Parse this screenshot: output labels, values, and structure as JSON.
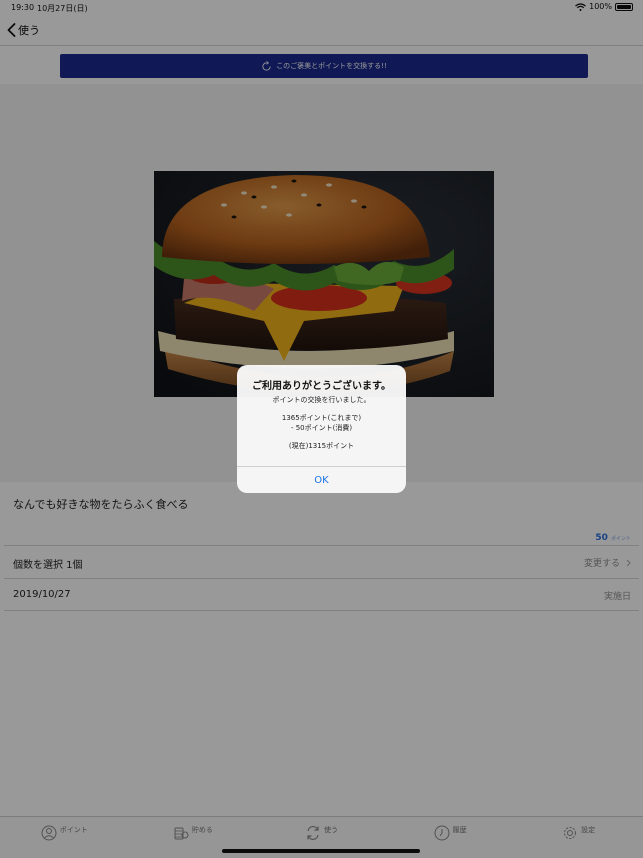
{
  "status_bar": {
    "time": "19:30",
    "date": "10月27日(日)",
    "battery": "100%"
  },
  "nav": {
    "back_label": "使う"
  },
  "exchange_button": {
    "label": "このご褒美とポイントを交換する!!"
  },
  "product": {
    "image": "hamburger-photo",
    "description": "なんでも好きな物をたらふく食べる",
    "points_value": "50",
    "points_unit": "ポイント"
  },
  "quantity_row": {
    "label": "個数を選択 1個",
    "action": "変更する"
  },
  "date_row": {
    "date": "2019/10/27",
    "label": "実施日"
  },
  "tab_bar": {
    "tabs": [
      {
        "label": "ポイント",
        "icon": "person-icon"
      },
      {
        "label": "貯める",
        "icon": "coins-icon"
      },
      {
        "label": "使う",
        "icon": "exchange-icon"
      },
      {
        "label": "履歴",
        "icon": "clock-icon"
      },
      {
        "label": "設定",
        "icon": "gear-icon"
      }
    ]
  },
  "alert": {
    "title": "ご利用ありがとうございます。",
    "message": "ポイントの交換を行いました。",
    "line_before": "1365ポイント(これまで)",
    "line_spent": "- 50ポイント(消費)",
    "line_now": "(現在)1315ポイント",
    "ok_label": "OK"
  },
  "colors": {
    "accent_blue": "#1b2a8e",
    "link_blue": "#1a73e8"
  }
}
